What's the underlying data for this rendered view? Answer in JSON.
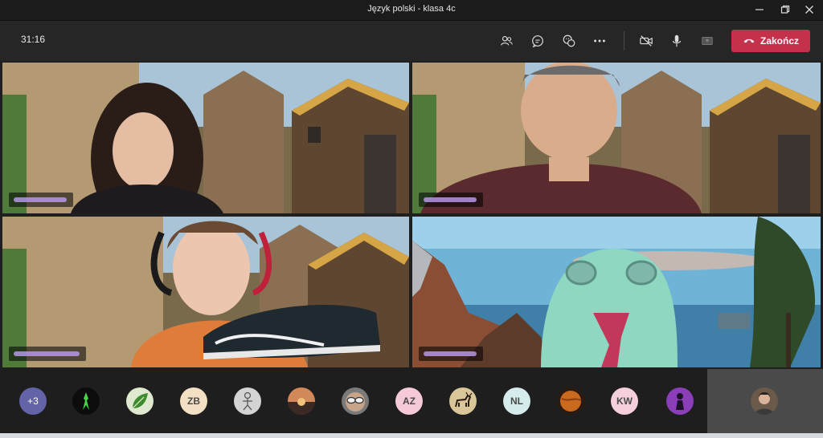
{
  "window": {
    "title": "Język polski - klasa 4c"
  },
  "callbar": {
    "timer": "31:16",
    "end_call_label": "Zakończ",
    "icons": [
      "participants-icon",
      "chat-icon",
      "reactions-icon",
      "more-icon",
      "camera-off-icon",
      "microphone-icon",
      "share-tray-icon"
    ]
  },
  "tiles": [
    {
      "name_redacted": true,
      "scene": "fantasy-village-background"
    },
    {
      "name_redacted": true,
      "scene": "fantasy-village-background"
    },
    {
      "name_redacted": true,
      "scene": "fantasy-village-background"
    },
    {
      "name_redacted": true,
      "scene": "coastal-island-background"
    }
  ],
  "participants_strip": {
    "overflow_label": "+3",
    "avatars": [
      {
        "type": "image",
        "name": "green-figure-avatar"
      },
      {
        "type": "image",
        "name": "green-leaf-avatar"
      },
      {
        "type": "initials",
        "text": "ZB",
        "color": "#f3dfc4"
      },
      {
        "type": "image",
        "name": "figure-sketch-avatar"
      },
      {
        "type": "image",
        "name": "sunset-avatar"
      },
      {
        "type": "image",
        "name": "sunglasses-avatar"
      },
      {
        "type": "initials",
        "text": "AZ",
        "color": "#f5c9d8"
      },
      {
        "type": "image",
        "name": "deer-avatar"
      },
      {
        "type": "initials",
        "text": "NL",
        "color": "#d6ecec"
      },
      {
        "type": "image",
        "name": "orange-planet-avatar"
      },
      {
        "type": "initials",
        "text": "KW",
        "color": "#f6cfdc"
      },
      {
        "type": "image",
        "name": "purple-character-avatar"
      }
    ]
  },
  "colors": {
    "end_call": "#c4314b",
    "toolbar": "#262626",
    "background": "#1f1f1f",
    "overflow_badge": "#6264a7"
  }
}
